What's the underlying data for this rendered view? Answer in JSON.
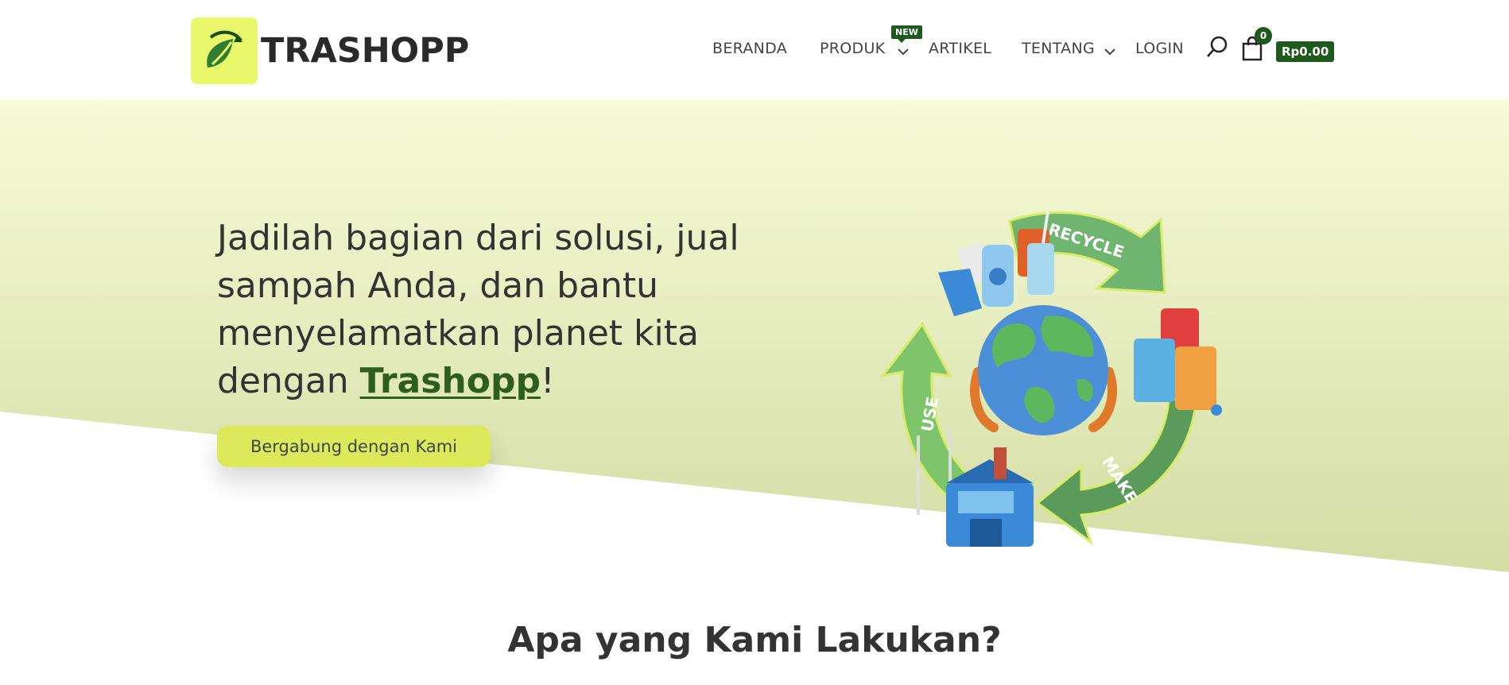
{
  "header": {
    "logo_text": "TRASHOPP",
    "nav": {
      "beranda": "BERANDA",
      "produk": "PRODUK",
      "produk_badge": "NEW",
      "artikel": "ARTIKEL",
      "tentang": "TENTANG",
      "login": "LOGIN"
    },
    "cart": {
      "count": "0",
      "total": "Rp0.00"
    }
  },
  "hero": {
    "text_line_1": "Jadilah bagian dari solusi, jual",
    "text_line_2": "sampah Anda, dan bantu",
    "text_line_3": "menyelamatkan planet kita",
    "text_line_4_prefix": "dengan ",
    "brand": "Trashopp",
    "text_suffix": "!",
    "button_label": "Bergabung dengan Kami",
    "illustration_labels": {
      "recycle": "RECYCLE",
      "use": "USE",
      "make": "MAKE"
    }
  },
  "section": {
    "title": "Apa yang Kami Lakukan?"
  },
  "colors": {
    "brand_green": "#1e5a1e",
    "logo_bg": "#e8f86a",
    "button_bg": "#dbe95a",
    "hero_top": "#f7fbd6",
    "hero_bottom": "#d6e0a8"
  },
  "icons": [
    "logo-leaf-icon",
    "chevron-down-icon",
    "search-icon",
    "shopping-bag-icon",
    "recycle-cycle-illustration"
  ]
}
